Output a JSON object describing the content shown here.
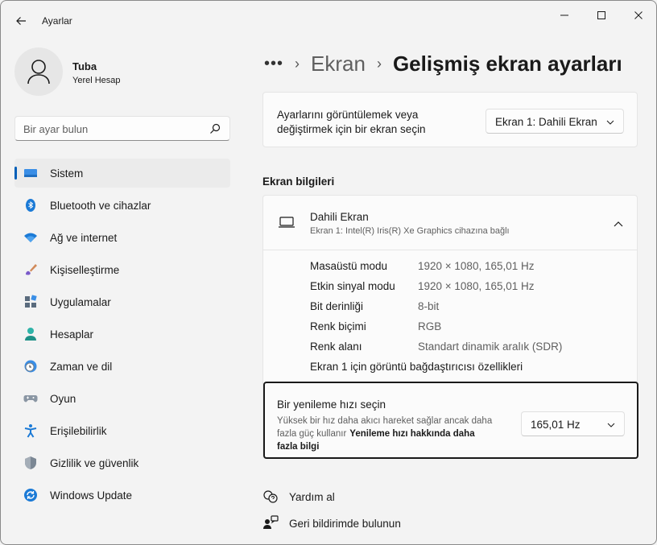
{
  "window": {
    "title": "Ayarlar"
  },
  "profile": {
    "name": "Tuba",
    "account_type": "Yerel Hesap"
  },
  "search": {
    "placeholder": "Bir ayar bulun"
  },
  "sidebar": {
    "items": [
      {
        "label": "Sistem",
        "icon": "monitor-icon",
        "active": true
      },
      {
        "label": "Bluetooth ve cihazlar",
        "icon": "bluetooth-icon",
        "active": false
      },
      {
        "label": "Ağ ve internet",
        "icon": "wifi-icon",
        "active": false
      },
      {
        "label": "Kişiselleştirme",
        "icon": "brush-icon",
        "active": false
      },
      {
        "label": "Uygulamalar",
        "icon": "apps-icon",
        "active": false
      },
      {
        "label": "Hesaplar",
        "icon": "person-icon",
        "active": false
      },
      {
        "label": "Zaman ve dil",
        "icon": "clock-globe-icon",
        "active": false
      },
      {
        "label": "Oyun",
        "icon": "gamepad-icon",
        "active": false
      },
      {
        "label": "Erişilebilirlik",
        "icon": "accessibility-icon",
        "active": false
      },
      {
        "label": "Gizlilik ve güvenlik",
        "icon": "shield-icon",
        "active": false
      },
      {
        "label": "Windows Update",
        "icon": "update-icon",
        "active": false
      }
    ]
  },
  "breadcrumb": {
    "more": "•••",
    "parent": "Ekran",
    "current": "Gelişmiş ekran ayarları"
  },
  "display_select": {
    "description_line1": "Ayarlarını görüntülemek veya",
    "description_line2": "değiştirmek için bir ekran seçin",
    "selected": "Ekran 1: Dahili Ekran"
  },
  "display_info": {
    "section_title": "Ekran bilgileri",
    "display_name": "Dahili Ekran",
    "display_sub": "Ekran 1: Intel(R) Iris(R) Xe Graphics cihazına bağlı",
    "rows": [
      {
        "key": "Masaüstü modu",
        "value": "1920 × 1080, 165,01 Hz"
      },
      {
        "key": "Etkin sinyal modu",
        "value": "1920 × 1080, 165,01 Hz"
      },
      {
        "key": "Bit derinliği",
        "value": "8-bit"
      },
      {
        "key": "Renk biçimi",
        "value": "RGB"
      },
      {
        "key": "Renk alanı",
        "value": "Standart dinamik aralık (SDR)"
      }
    ],
    "adapter_link": "Ekran 1 için görüntü bağdaştırıcısı özellikleri"
  },
  "refresh_rate": {
    "title": "Bir yenileme hızı seçin",
    "desc_line1": "Yüksek bir hız daha akıcı hareket sağlar ancak daha",
    "desc_line2": "fazla güç kullanır",
    "link_part1": "Yenileme hızı hakkında daha",
    "link_part2": "fazla bilgi",
    "selected": "165,01 Hz"
  },
  "footer": {
    "help": "Yardım al",
    "feedback": "Geri bildirimde bulunun"
  },
  "colors": {
    "accent": "#005fb8",
    "background": "#f3f3f3",
    "card": "#fbfbfb"
  }
}
